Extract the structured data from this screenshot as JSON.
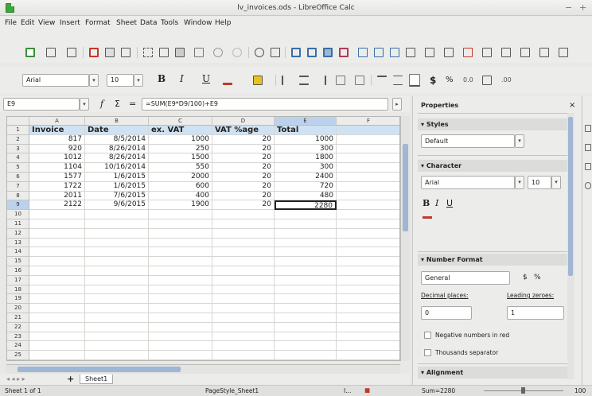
{
  "window": {
    "title": "lv_invoices.ods - LibreOffice Calc",
    "minimize": "−",
    "close": "+"
  },
  "menu": [
    "File",
    "Edit",
    "View",
    "Insert",
    "Format",
    "Sheet",
    "Data",
    "Tools",
    "Window",
    "Help"
  ],
  "toolbar": {
    "font_name": "Arial",
    "font_size": "10",
    "bold": "B",
    "italic": "I",
    "underline": "U"
  },
  "formula": {
    "cell_ref": "E9",
    "fx": "f",
    "sigma": "Σ",
    "equals": "=",
    "content": "=SUM(E9*D9/100)+E9"
  },
  "sheet": {
    "columns": [
      "A",
      "B",
      "C",
      "D",
      "E",
      "F"
    ],
    "header_row": [
      "Invoice",
      "Date",
      "ex. VAT",
      "VAT %age",
      "Total",
      ""
    ],
    "rows": [
      [
        "817",
        "8/5/2014",
        "1000",
        "20",
        "1000",
        ""
      ],
      [
        "920",
        "8/26/2014",
        "250",
        "20",
        "300",
        ""
      ],
      [
        "1012",
        "8/26/2014",
        "1500",
        "20",
        "1800",
        ""
      ],
      [
        "1104",
        "10/16/2014",
        "550",
        "20",
        "300",
        ""
      ],
      [
        "1577",
        "1/6/2015",
        "2000",
        "20",
        "2400",
        ""
      ],
      [
        "1722",
        "1/6/2015",
        "600",
        "20",
        "720",
        ""
      ],
      [
        "2011",
        "7/6/2015",
        "400",
        "20",
        "480",
        ""
      ],
      [
        "2122",
        "9/6/2015",
        "1900",
        "20",
        "2280",
        ""
      ]
    ],
    "row_numbers": [
      "1",
      "2",
      "3",
      "4",
      "5",
      "6",
      "7",
      "8",
      "9",
      "10",
      "11",
      "12",
      "13",
      "14",
      "15",
      "16",
      "17",
      "18",
      "19",
      "20",
      "21",
      "22",
      "23",
      "24",
      "25"
    ],
    "tab": "Sheet1",
    "add_tab": "+"
  },
  "status": {
    "sheet": "Sheet 1 of 1",
    "style": "PageStyle_Sheet1",
    "zoom_value": "Sum=2280",
    "zoom": "100"
  },
  "sidebar": {
    "title": "Properties",
    "close": "×",
    "styles_title": "Styles",
    "style_value": "Default",
    "character_title": "Character",
    "char_font": "Arial",
    "char_size": "10",
    "number_format_title": "Number Format",
    "number_format_value": "General",
    "decimal_label": "Decimal places:",
    "leading_label": "Leading zeroes:",
    "decimal_value": "0",
    "leading_value": "1",
    "negative_label": "Negative numbers in red",
    "thousands_label": "Thousands separator",
    "alignment_title": "Alignment"
  }
}
